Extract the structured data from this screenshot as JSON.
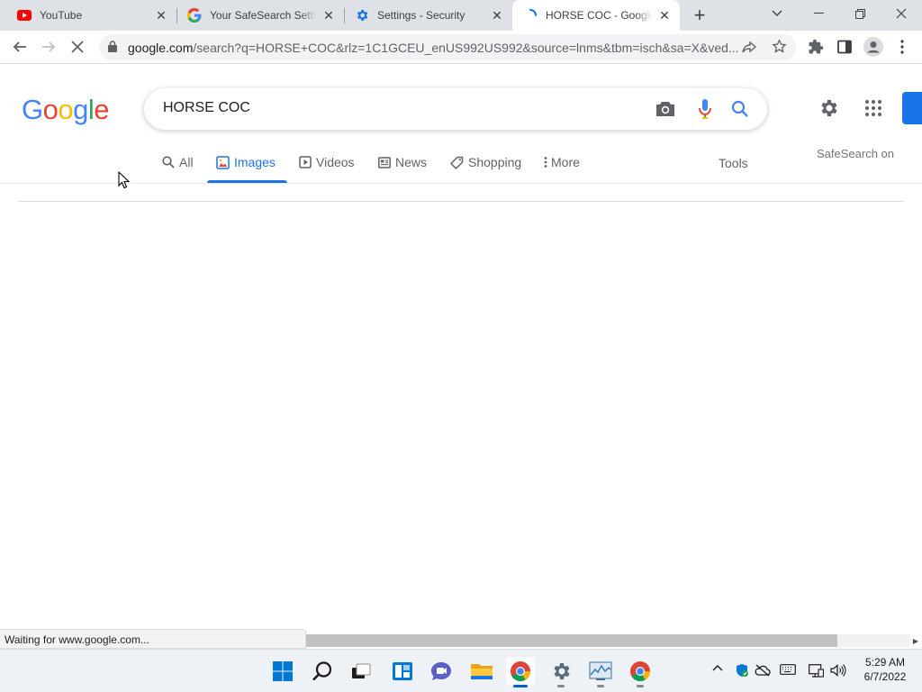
{
  "tabs": [
    {
      "title": "YouTube",
      "favicon": "youtube-icon",
      "active": false
    },
    {
      "title": "Your SafeSearch Settings",
      "favicon": "google-g-icon",
      "active": false
    },
    {
      "title": "Settings - Security",
      "favicon": "settings-gear-icon",
      "active": false
    },
    {
      "title": "HORSE COC - Google Search",
      "favicon": "loading-spinner-icon",
      "active": true
    }
  ],
  "omnibox": {
    "host": "google.com",
    "path": "/search?q=HORSE+COC&rlz=1C1GCEU_enUS992US992&source=lnms&tbm=isch&sa=X&ved..."
  },
  "google": {
    "logo": [
      "G",
      "o",
      "o",
      "g",
      "l",
      "e"
    ],
    "logo_colors": [
      "#4285F4",
      "#EA4335",
      "#FBBC05",
      "#4285F4",
      "#34A853",
      "#EA4335"
    ],
    "query": "HORSE COC",
    "nav": [
      {
        "label": "All",
        "icon": "search-icon"
      },
      {
        "label": "Images",
        "icon": "image-icon"
      },
      {
        "label": "Videos",
        "icon": "play-icon"
      },
      {
        "label": "News",
        "icon": "news-icon"
      },
      {
        "label": "Shopping",
        "icon": "tag-icon"
      },
      {
        "label": "More",
        "icon": "more-vert-icon"
      }
    ],
    "tools": "Tools",
    "safesearch": "SafeSearch on",
    "accent": "#1a73e8"
  },
  "status": "Waiting for www.google.com...",
  "clock": {
    "time": "5:29 AM",
    "date": "6/7/2022"
  }
}
